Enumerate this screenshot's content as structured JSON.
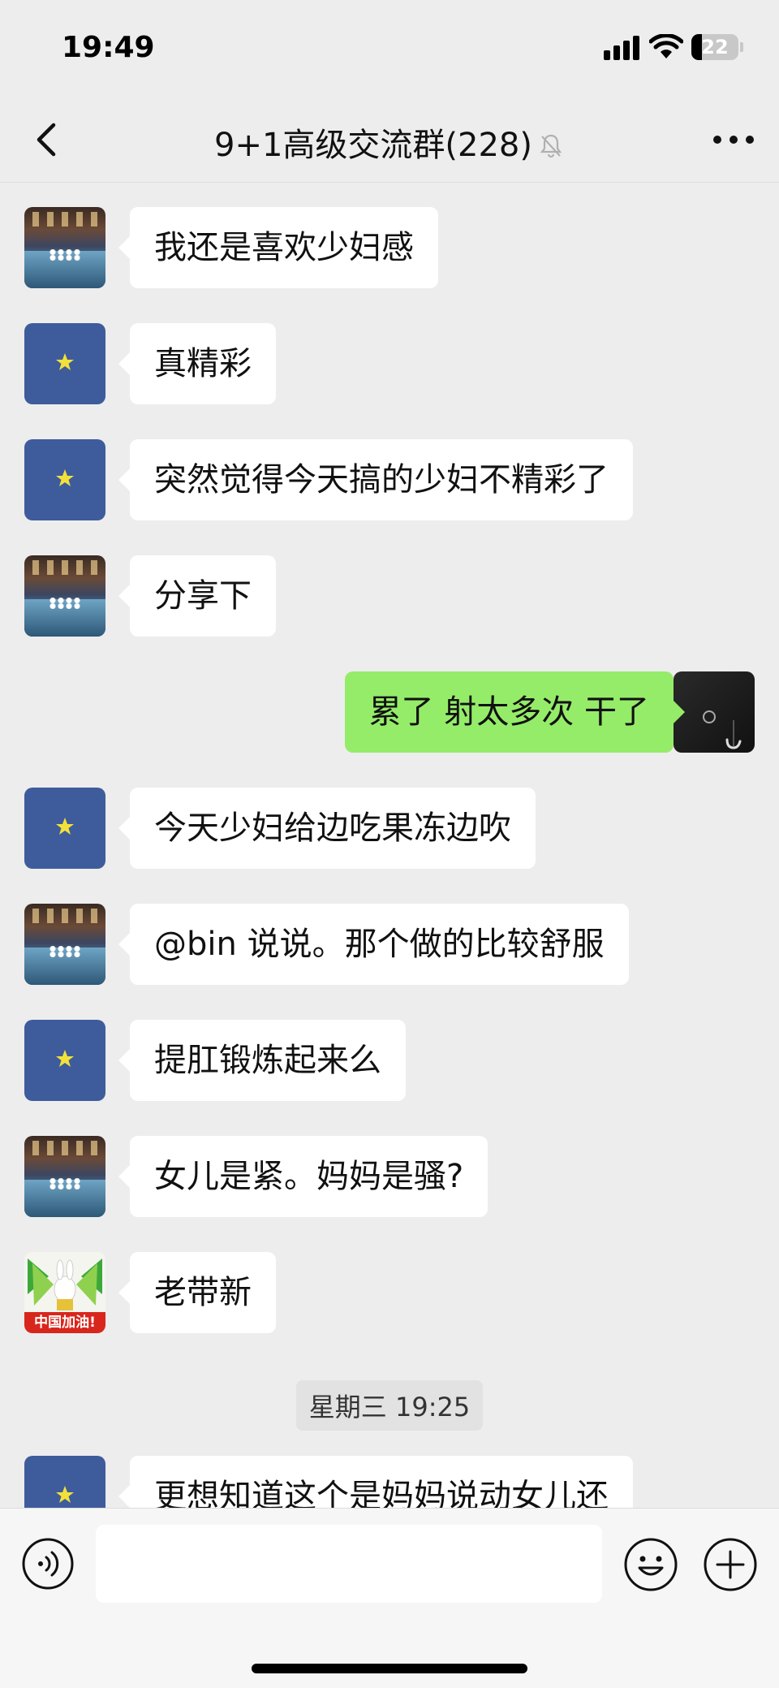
{
  "status_bar": {
    "time": "19:49",
    "battery": "22"
  },
  "nav": {
    "title": "9+1高级交流群(228)"
  },
  "messages": [
    {
      "side": "left",
      "avatar": "room-avatar",
      "text": "我还是喜欢少妇感"
    },
    {
      "side": "left",
      "avatar": "star-avatar",
      "text": "真精彩"
    },
    {
      "side": "left",
      "avatar": "star-avatar",
      "text": "突然觉得今天搞的少妇不精彩了"
    },
    {
      "side": "left",
      "avatar": "room-avatar",
      "text": "分享下"
    },
    {
      "side": "right",
      "avatar": "dark-avatar",
      "text": "累了 射太多次 干了"
    },
    {
      "side": "left",
      "avatar": "star-avatar",
      "text": "今天少妇给边吃果冻边吹"
    },
    {
      "side": "left",
      "avatar": "room-avatar",
      "text": "@bin 说说。那个做的比较舒服"
    },
    {
      "side": "left",
      "avatar": "star-avatar",
      "text": "提肛锻炼起来么"
    },
    {
      "side": "left",
      "avatar": "room-avatar",
      "text": "女儿是紧。妈妈是骚?"
    },
    {
      "side": "left",
      "avatar": "green-avatar",
      "text": "老带新"
    },
    {
      "side": "left",
      "avatar": "star-avatar",
      "text": "更想知道这个是妈妈说动女儿还"
    }
  ],
  "time_divider": "星期三 19:25",
  "avatar_badge_text": "中国加油!",
  "input": {
    "value": "",
    "placeholder": ""
  },
  "colors": {
    "background": "#ededed",
    "self_bubble": "#95ec69",
    "other_bubble": "#ffffff",
    "input_bar": "#f6f6f6"
  },
  "icons": [
    "back-icon",
    "mute-bell-icon",
    "more-dots-icon",
    "voice-icon",
    "emoji-icon",
    "plus-icon",
    "signal-icon",
    "wifi-icon",
    "battery-icon"
  ]
}
